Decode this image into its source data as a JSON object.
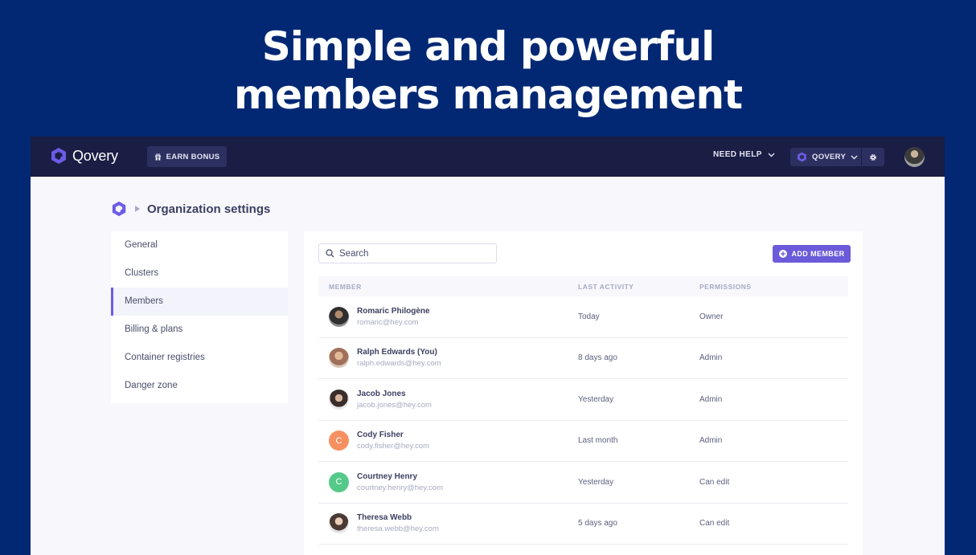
{
  "hero": {
    "line1": "Simple and powerful",
    "line2": "members management"
  },
  "topbar": {
    "logo_text": "Qovery",
    "earn_bonus": "EARN BONUS",
    "need_help": "NEED HELP",
    "org_name": "QOVERY"
  },
  "breadcrumb": {
    "title": "Organization settings"
  },
  "sidebar": {
    "items": [
      {
        "label": "General"
      },
      {
        "label": "Clusters"
      },
      {
        "label": "Members"
      },
      {
        "label": "Billing & plans"
      },
      {
        "label": "Container registries"
      },
      {
        "label": "Danger zone"
      }
    ],
    "active": "Members"
  },
  "main": {
    "search_placeholder": "Search",
    "add_member": "ADD MEMBER",
    "columns": {
      "member": "MEMBER",
      "last_activity": "LAST ACTIVITY",
      "permissions": "PERMISSIONS"
    },
    "rows": [
      {
        "name": "Romaric Philogène",
        "email": "romaric@hey.com",
        "activity": "Today",
        "permission": "Owner",
        "avatar": "photo",
        "color": "#3a3a3a"
      },
      {
        "name": "Ralph Edwards (You)",
        "email": "ralph.edwards@hey.com",
        "activity": "8 days ago",
        "permission": "Admin",
        "avatar": "photo",
        "color": "#c49a7a"
      },
      {
        "name": "Jacob Jones",
        "email": "jacob.jones@hey.com",
        "activity": "Yesterday",
        "permission": "Admin",
        "avatar": "photo",
        "color": "#5a4a44"
      },
      {
        "name": "Cody Fisher",
        "email": "cody.fisher@hey.com",
        "activity": "Last month",
        "permission": "Admin",
        "avatar": "C",
        "color": "#f69061"
      },
      {
        "name": "Courtney Henry",
        "email": "courtney.henry@hey.com",
        "activity": "Yesterday",
        "permission": "Can edit",
        "avatar": "C",
        "color": "#55c98a"
      },
      {
        "name": "Theresa Webb",
        "email": "theresa.webb@hey.com",
        "activity": "5 days ago",
        "permission": "Can edit",
        "avatar": "photo",
        "color": "#b8a89a"
      }
    ]
  }
}
